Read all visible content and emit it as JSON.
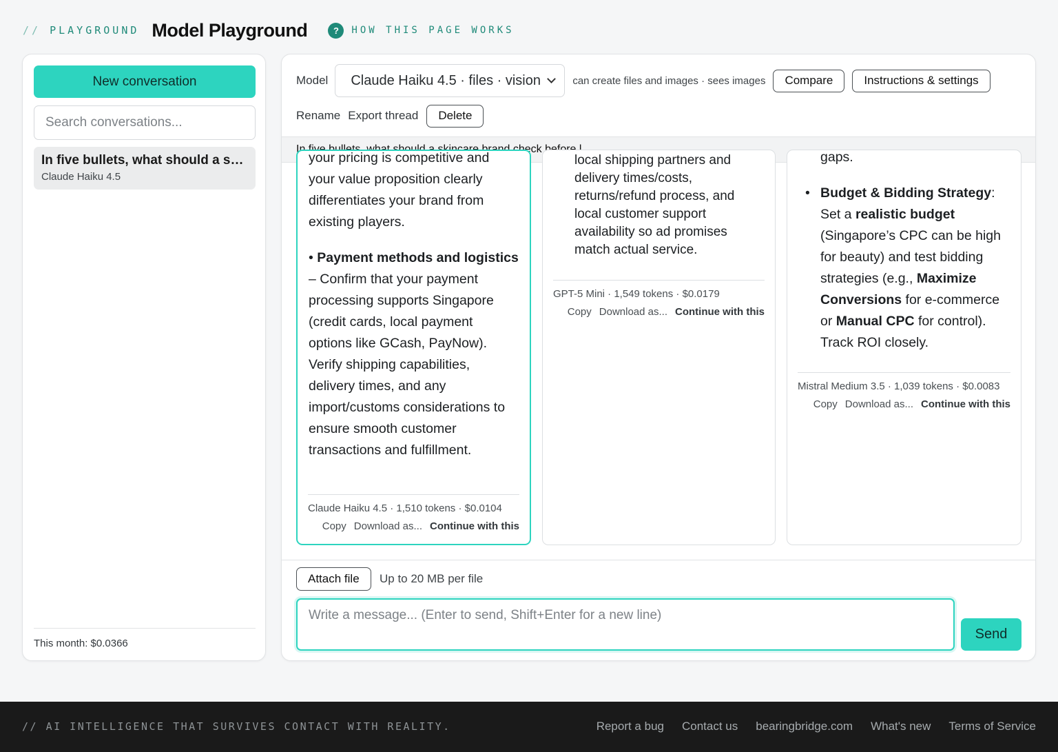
{
  "header": {
    "tag_slashes": "//",
    "tag": "PLAYGROUND",
    "title": "Model Playground",
    "help_icon": "?",
    "help_label": "HOW THIS PAGE WORKS"
  },
  "sidebar": {
    "new_conversation": "New conversation",
    "search_placeholder": "Search conversations...",
    "conversations": [
      {
        "title": "In five bullets, what should a ski...",
        "model": "Claude Haiku 4.5"
      }
    ],
    "month_cost": "This month: $0.0366"
  },
  "toolbar": {
    "model_label": "Model",
    "model_selected": "Claude Haiku 4.5 · files · vision",
    "capabilities": "can create files and images · sees images",
    "compare": "Compare",
    "instructions": "Instructions & settings",
    "rename": "Rename",
    "export": "Export thread",
    "delete": "Delete"
  },
  "prompt": "In five bullets, what should a skincare brand check before l",
  "responses": [
    {
      "p1": "your pricing is competitive and your value proposition clearly differentiates your brand from existing players.",
      "b_title": "Payment methods and logistics",
      "b_text": "– Confirm that your payment processing supports Singapore (credit cards, local payment options like GCash, PayNow). Verify shipping capabilities, delivery times, and any import/customs considerations to ensure smooth customer transactions and fulfillment.",
      "meta": "Claude Haiku 4.5 · 1,510 tokens · $0.0104",
      "copy": "Copy",
      "download": "Download as...",
      "continue": "Continue with this"
    },
    {
      "p1": "local shipping partners and delivery times/costs, returns/refund process, and local customer support availability so ad promises match actual service.",
      "meta": "GPT-5 Mini · 1,549 tokens · $0.0179",
      "copy": "Copy",
      "download": "Download as...",
      "continue": "Continue with this"
    },
    {
      "p0": "gaps.",
      "b1": "Budget & Bidding Strategy",
      "t1": ": Set a ",
      "b2": "realistic budget",
      "t2": " (Singapore’s CPC can be high for beauty) and test bidding strategies (e.g., ",
      "b3": "Maximize Conversions",
      "t3": " for e-commerce or ",
      "b4": "Manual CPC",
      "t4": " for control). Track ROI closely.",
      "meta": "Mistral Medium 3.5 · 1,039 tokens · $0.0083",
      "copy": "Copy",
      "download": "Download as...",
      "continue": "Continue with this"
    }
  ],
  "composer": {
    "attach": "Attach file",
    "size_note": "Up to 20 MB per file",
    "placeholder": "Write a message... (Enter to send, Shift+Enter for a new line)",
    "send": "Send"
  },
  "footer": {
    "tagline": "// AI INTELLIGENCE THAT SURVIVES CONTACT WITH REALITY.",
    "links": [
      "Report a bug",
      "Contact us",
      "bearingbridge.com",
      "What's new",
      "Terms of Service"
    ]
  },
  "colors": {
    "accent": "#2dd4bf",
    "accent_dark": "#1f8a79",
    "footer_bg": "#1a1a1a"
  }
}
